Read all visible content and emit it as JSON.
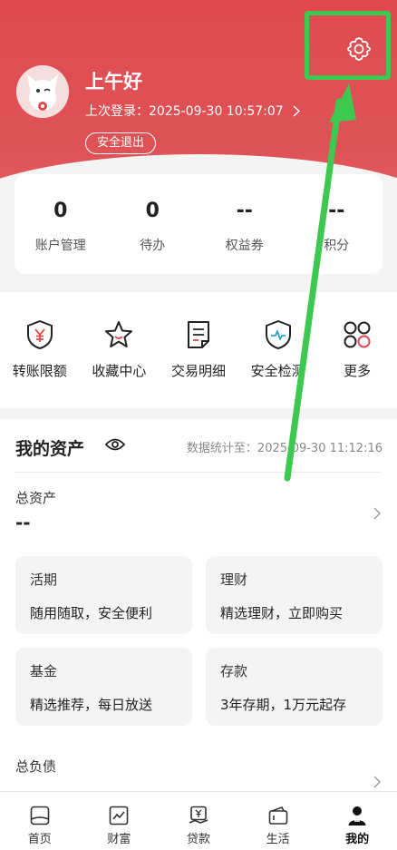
{
  "header": {
    "greeting": "上午好",
    "last_login_label": "上次登录：",
    "last_login_time": "2025-09-30 10:57:07",
    "logout_label": "安全退出",
    "settings_icon": "gear-icon",
    "background_color": "#e04a4e"
  },
  "stats": [
    {
      "value": "0",
      "label": "账户管理"
    },
    {
      "value": "0",
      "label": "待办"
    },
    {
      "value": "--",
      "label": "权益券"
    },
    {
      "value": "--",
      "label": "积分"
    }
  ],
  "quick_actions": [
    {
      "label": "转账限额",
      "icon": "yen-shield-icon"
    },
    {
      "label": "收藏中心",
      "icon": "star-icon"
    },
    {
      "label": "交易明细",
      "icon": "document-icon"
    },
    {
      "label": "安全检测",
      "icon": "shield-pulse-icon"
    },
    {
      "label": "更多",
      "icon": "grid-icon"
    }
  ],
  "assets": {
    "title": "我的资产",
    "stat_time_label": "数据统计至：",
    "stat_time": "2025-09-30 11:12:16",
    "total_label": "总资产",
    "total_value": "--",
    "products": [
      {
        "name": "活期",
        "desc": "随用随取，安全便利"
      },
      {
        "name": "理财",
        "desc": "精选理财，立即购买"
      },
      {
        "name": "基金",
        "desc": "精选推荐，每日放送"
      },
      {
        "name": "存款",
        "desc": "3年存期，1万元起存"
      }
    ],
    "debt_label": "总负债"
  },
  "nav": [
    {
      "label": "首页",
      "icon": "home-icon"
    },
    {
      "label": "财富",
      "icon": "chart-icon"
    },
    {
      "label": "贷款",
      "icon": "loan-icon"
    },
    {
      "label": "生活",
      "icon": "wallet-icon"
    },
    {
      "label": "我的",
      "icon": "user-icon",
      "active": true
    }
  ],
  "colors": {
    "accent_red": "#e04a4e",
    "annotation_green": "#3dc84f"
  }
}
